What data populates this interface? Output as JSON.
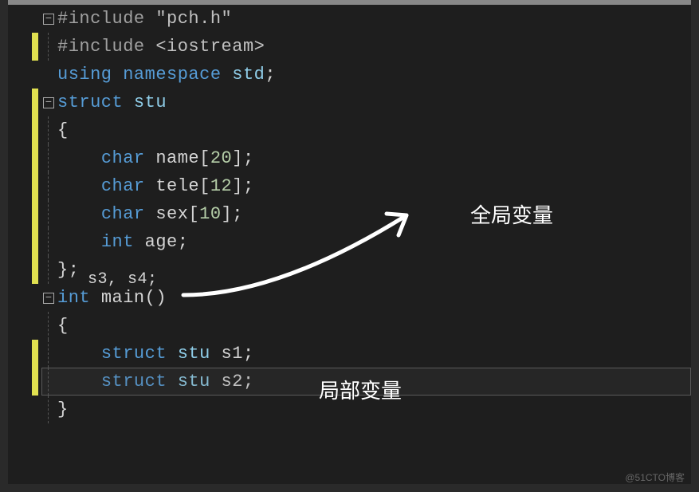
{
  "code": {
    "l1": {
      "pp": "#include ",
      "str": "\"pch.h\""
    },
    "l2": {
      "pp": "#include ",
      "ang": "<iostream>"
    },
    "l3": {
      "kw1": "using ",
      "kw2": "namespace ",
      "id": "std",
      "sc": ";"
    },
    "l4": {
      "kw": "struct ",
      "id": "stu"
    },
    "l5": {
      "br": "{"
    },
    "l6": {
      "ty": "char ",
      "id": "name",
      "br": "[",
      "num": "20",
      "br2": "];"
    },
    "l7": {
      "ty": "char ",
      "id": "tele",
      "br": "[",
      "num": "12",
      "br2": "];"
    },
    "l8": {
      "ty": "char ",
      "id": "sex",
      "br": "[",
      "num": "10",
      "br2": "];"
    },
    "l9": {
      "ty": "int ",
      "id": "age",
      "sc": ";"
    },
    "l10": {
      "br": "};"
    },
    "l10b": {
      "txt": "s3, s4;"
    },
    "l11": {
      "ty": "int ",
      "id": "main",
      "par": "()"
    },
    "l12": {
      "br": "{"
    },
    "l13": {
      "kw": "struct ",
      "ty": "stu ",
      "id": "s1",
      "sc": ";"
    },
    "l14": {
      "kw": "struct ",
      "ty": "stu ",
      "id": "s2",
      "sc": ";"
    },
    "l15": {
      "br": "}"
    }
  },
  "annot": {
    "global": "全局变量",
    "local": "局部变量"
  },
  "fold": {
    "minus": "−"
  },
  "watermark": "@51CTO博客"
}
